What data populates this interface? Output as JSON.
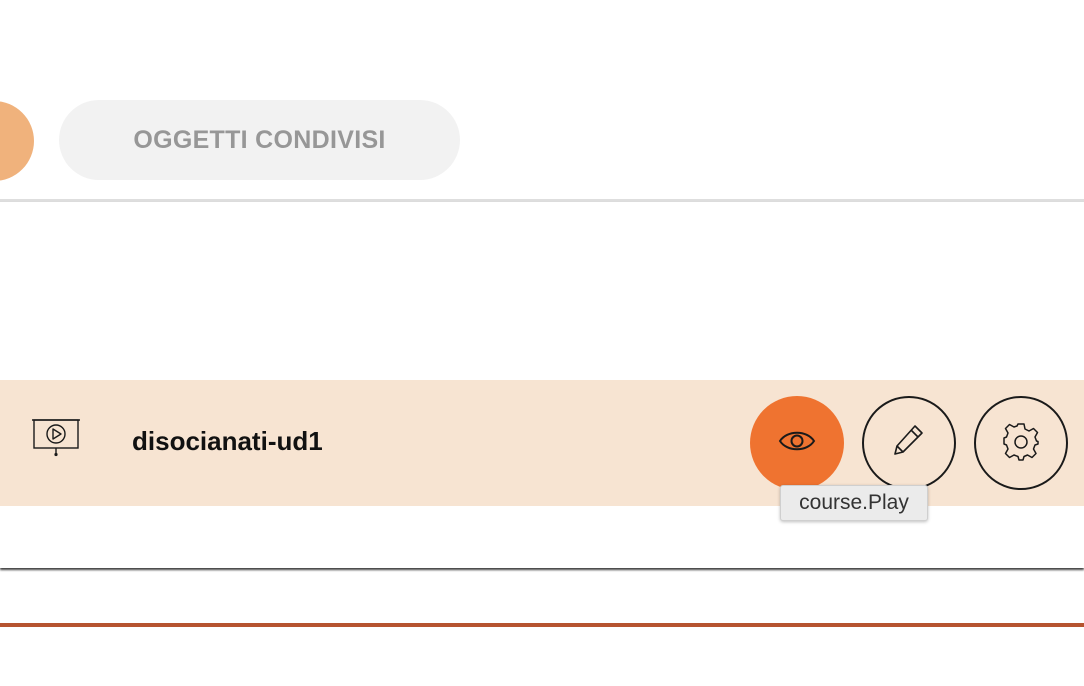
{
  "tabs": {
    "shared_label": "OGGETTI CONDIVISI"
  },
  "course_row": {
    "title": "disocianati-ud1",
    "icon": "presentation-play-icon",
    "actions": [
      {
        "name": "play",
        "icon": "eye-icon",
        "color": "#ef7330"
      },
      {
        "name": "edit",
        "icon": "pencil-icon"
      },
      {
        "name": "settings",
        "icon": "gear-icon"
      }
    ]
  },
  "tooltip": {
    "text": "course.Play"
  },
  "colors": {
    "accent": "#ef7330",
    "row_background": "#f7e4d2",
    "partial_tab": "#f0b27c",
    "divider": "#b65430"
  }
}
